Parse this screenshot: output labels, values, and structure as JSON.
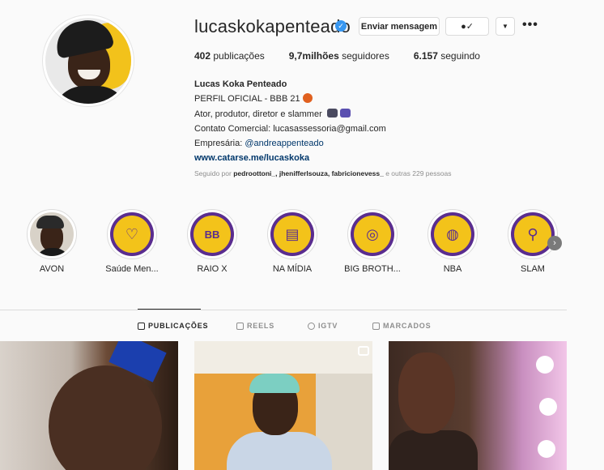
{
  "profile": {
    "username": "lucaskokapenteado",
    "verified_icon": "verified-badge-icon",
    "message_button": "Enviar mensagem",
    "follow_icon": "person-check-icon",
    "dropdown_icon": "chevron-down-icon",
    "more_icon": "more-options-icon",
    "more_glyph": "•••",
    "stats": {
      "posts_count": "402",
      "posts_label": "publicações",
      "followers_count": "9,7milhões",
      "followers_label": "seguidores",
      "following_count": "6.157",
      "following_label": "seguindo"
    },
    "bio": {
      "name": "Lucas Koka Penteado",
      "line1": "PERFIL OFICIAL - BBB 21",
      "line2": "Ator, produtor, diretor e slammer",
      "line3": "Contato Comercial: lucasassessoria@gmail.com",
      "line4_prefix": "Empresária: ",
      "line4_mention": "@andreappenteado",
      "link": "www.catarse.me/lucaskoka"
    },
    "followed_by": {
      "prefix": "Seguido por ",
      "names": "pedroottoni_, jhenifferlsouza, fabricionevess_",
      "suffix": " e outras 229 pessoas"
    }
  },
  "highlights": [
    {
      "label": "AVON",
      "icon": "photo"
    },
    {
      "label": "Saúde Men...",
      "icon": "brain-heart-icon"
    },
    {
      "label": "RAIO X",
      "icon": "bbb-logo-icon"
    },
    {
      "label": "NA MÍDIA",
      "icon": "newspaper-icon"
    },
    {
      "label": "BIG BROTH...",
      "icon": "webcam-icon"
    },
    {
      "label": "NBA",
      "icon": "basketball-icon"
    },
    {
      "label": "SLAM",
      "icon": "microphone-icon"
    }
  ],
  "highlight_glyphs": {
    "brain": "♡",
    "bbb": "BB",
    "news": "▤",
    "cam": "◎",
    "ball": "◍",
    "mic": "⚲",
    "next": "›"
  },
  "tabs": [
    {
      "label": "PUBLICAÇÕES",
      "icon": "grid-icon",
      "active": true
    },
    {
      "label": "REELS",
      "icon": "reels-icon",
      "active": false
    },
    {
      "label": "IGTV",
      "icon": "igtv-icon",
      "active": false
    },
    {
      "label": "MARCADOS",
      "icon": "tagged-icon",
      "active": false
    }
  ],
  "colors": {
    "accent_purple": "#5a2d8f",
    "highlight_yellow": "#f3c31a",
    "verified_blue": "#3897f0",
    "link_blue": "#00376b"
  }
}
